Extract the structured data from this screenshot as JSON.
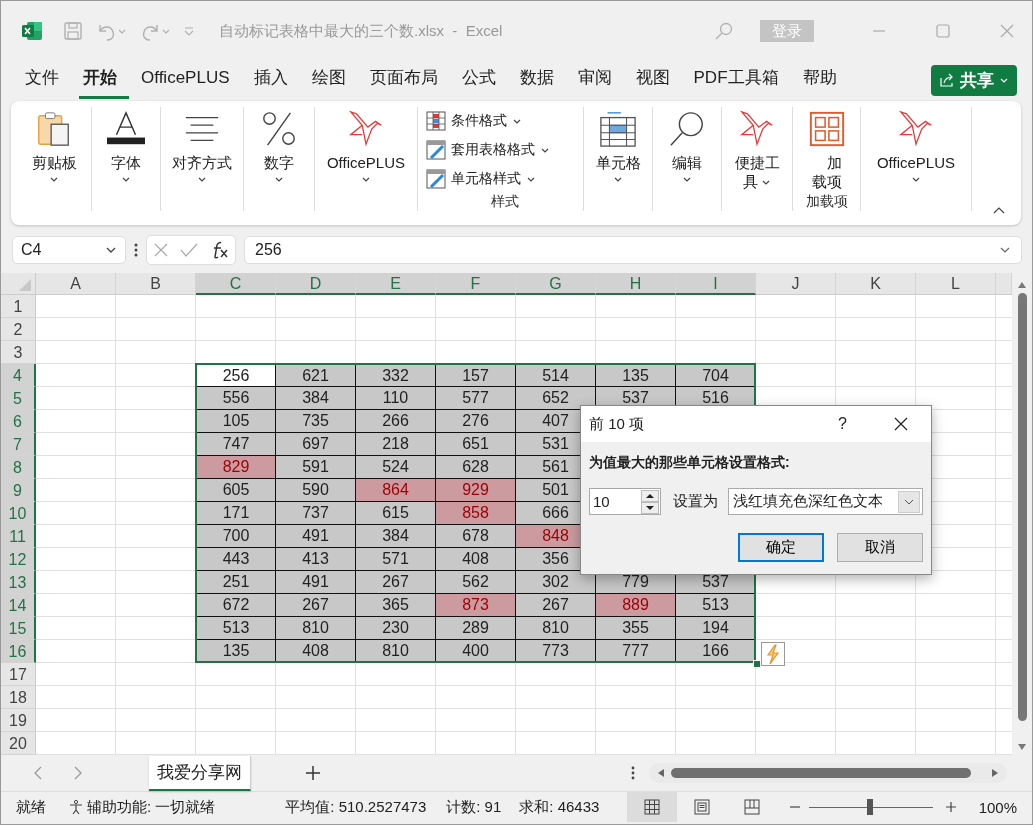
{
  "title_bar": {
    "title": "自动标记表格中最大的三个数.xlsx  -  Excel",
    "sign_in": "登录"
  },
  "menu_tabs": [
    {
      "label": "文件",
      "selected": false
    },
    {
      "label": "开始",
      "selected": true
    },
    {
      "label": "OfficePLUS",
      "selected": false
    },
    {
      "label": "插入",
      "selected": false
    },
    {
      "label": "绘图",
      "selected": false
    },
    {
      "label": "页面布局",
      "selected": false
    },
    {
      "label": "公式",
      "selected": false
    },
    {
      "label": "数据",
      "selected": false
    },
    {
      "label": "审阅",
      "selected": false
    },
    {
      "label": "视图",
      "selected": false
    },
    {
      "label": "PDF工具箱",
      "selected": false
    },
    {
      "label": "帮助",
      "selected": false
    }
  ],
  "share_button": "共享",
  "ribbon": {
    "items": [
      {
        "kind": "large",
        "label": "剪贴板",
        "dropdown": true
      },
      {
        "kind": "large",
        "label": "字体",
        "dropdown": true
      },
      {
        "kind": "large",
        "label": "对齐方式",
        "dropdown": true
      },
      {
        "kind": "large",
        "label": "数字",
        "dropdown": true
      },
      {
        "kind": "large",
        "label": "OfficePLUS",
        "dropdown": true
      },
      {
        "kind": "stack",
        "entries": [
          "条件格式",
          "套用表格格式",
          "单元格样式"
        ],
        "group_label": "样式"
      },
      {
        "kind": "large",
        "label": "单元格",
        "dropdown": true
      },
      {
        "kind": "large",
        "label": "编辑",
        "dropdown": true
      },
      {
        "kind": "large",
        "label": "便捷工具",
        "dropdown": true
      },
      {
        "kind": "large",
        "label": "加载项",
        "dropdown": false,
        "group_label": "加载项"
      },
      {
        "kind": "large",
        "label": "OfficePLUS",
        "dropdown": true
      }
    ]
  },
  "formula_bar": {
    "name_box": "C4",
    "formula": "256"
  },
  "sheet": {
    "columns": [
      {
        "label": "A",
        "selected": false
      },
      {
        "label": "B",
        "selected": false
      },
      {
        "label": "C",
        "selected": true
      },
      {
        "label": "D",
        "selected": true
      },
      {
        "label": "E",
        "selected": true
      },
      {
        "label": "F",
        "selected": true
      },
      {
        "label": "G",
        "selected": true
      },
      {
        "label": "H",
        "selected": true
      },
      {
        "label": "I",
        "selected": true
      },
      {
        "label": "J",
        "selected": false
      },
      {
        "label": "K",
        "selected": false
      },
      {
        "label": "L",
        "selected": false
      }
    ],
    "row_headers": [
      {
        "label": "1",
        "selected": false
      },
      {
        "label": "2",
        "selected": false
      },
      {
        "label": "3",
        "selected": false
      },
      {
        "label": "4",
        "selected": true
      },
      {
        "label": "5",
        "selected": true
      },
      {
        "label": "6",
        "selected": true
      },
      {
        "label": "7",
        "selected": true
      },
      {
        "label": "8",
        "selected": true
      },
      {
        "label": "9",
        "selected": true
      },
      {
        "label": "10",
        "selected": true
      },
      {
        "label": "11",
        "selected": true
      },
      {
        "label": "12",
        "selected": true
      },
      {
        "label": "13",
        "selected": true
      },
      {
        "label": "14",
        "selected": true
      },
      {
        "label": "15",
        "selected": true
      },
      {
        "label": "16",
        "selected": true
      },
      {
        "label": "17",
        "selected": false
      },
      {
        "label": "18",
        "selected": false
      },
      {
        "label": "19",
        "selected": false
      },
      {
        "label": "20",
        "selected": false
      }
    ],
    "data": [
      [
        {
          "text": "256",
          "highlight": false,
          "active": true
        },
        {
          "text": "621",
          "highlight": false,
          "active": false
        },
        {
          "text": "332",
          "highlight": false,
          "active": false
        },
        {
          "text": "157",
          "highlight": false,
          "active": false
        },
        {
          "text": "514",
          "highlight": false,
          "active": false
        },
        {
          "text": "135",
          "highlight": false,
          "active": false
        },
        {
          "text": "704",
          "highlight": false,
          "active": false
        }
      ],
      [
        {
          "text": "556",
          "highlight": false,
          "active": false
        },
        {
          "text": "384",
          "highlight": false,
          "active": false
        },
        {
          "text": "110",
          "highlight": false,
          "active": false
        },
        {
          "text": "577",
          "highlight": false,
          "active": false
        },
        {
          "text": "652",
          "highlight": false,
          "active": false
        },
        {
          "text": "537",
          "highlight": false,
          "active": false
        },
        {
          "text": "516",
          "highlight": false,
          "active": false
        }
      ],
      [
        {
          "text": "105",
          "highlight": false,
          "active": false
        },
        {
          "text": "735",
          "highlight": false,
          "active": false
        },
        {
          "text": "266",
          "highlight": false,
          "active": false
        },
        {
          "text": "276",
          "highlight": false,
          "active": false
        },
        {
          "text": "407",
          "highlight": false,
          "active": false
        }
      ],
      [
        {
          "text": "747",
          "highlight": false,
          "active": false
        },
        {
          "text": "697",
          "highlight": false,
          "active": false
        },
        {
          "text": "218",
          "highlight": false,
          "active": false
        },
        {
          "text": "651",
          "highlight": false,
          "active": false
        },
        {
          "text": "531",
          "highlight": false,
          "active": false
        }
      ],
      [
        {
          "text": "829",
          "highlight": true,
          "active": false
        },
        {
          "text": "591",
          "highlight": false,
          "active": false
        },
        {
          "text": "524",
          "highlight": false,
          "active": false
        },
        {
          "text": "628",
          "highlight": false,
          "active": false
        },
        {
          "text": "561",
          "highlight": false,
          "active": false
        }
      ],
      [
        {
          "text": "605",
          "highlight": false,
          "active": false
        },
        {
          "text": "590",
          "highlight": false,
          "active": false
        },
        {
          "text": "864",
          "highlight": true,
          "active": false
        },
        {
          "text": "929",
          "highlight": true,
          "active": false
        },
        {
          "text": "501",
          "highlight": false,
          "active": false
        }
      ],
      [
        {
          "text": "171",
          "highlight": false,
          "active": false
        },
        {
          "text": "737",
          "highlight": false,
          "active": false
        },
        {
          "text": "615",
          "highlight": false,
          "active": false
        },
        {
          "text": "858",
          "highlight": true,
          "active": false
        },
        {
          "text": "666",
          "highlight": false,
          "active": false
        }
      ],
      [
        {
          "text": "700",
          "highlight": false,
          "active": false
        },
        {
          "text": "491",
          "highlight": false,
          "active": false
        },
        {
          "text": "384",
          "highlight": false,
          "active": false
        },
        {
          "text": "678",
          "highlight": false,
          "active": false
        },
        {
          "text": "848",
          "highlight": true,
          "active": false
        }
      ],
      [
        {
          "text": "443",
          "highlight": false,
          "active": false
        },
        {
          "text": "413",
          "highlight": false,
          "active": false
        },
        {
          "text": "571",
          "highlight": false,
          "active": false
        },
        {
          "text": "408",
          "highlight": false,
          "active": false
        },
        {
          "text": "356",
          "highlight": false,
          "active": false
        }
      ],
      [
        {
          "text": "251",
          "highlight": false,
          "active": false
        },
        {
          "text": "491",
          "highlight": false,
          "active": false
        },
        {
          "text": "267",
          "highlight": false,
          "active": false
        },
        {
          "text": "562",
          "highlight": false,
          "active": false
        },
        {
          "text": "302",
          "highlight": false,
          "active": false
        },
        {
          "text": "779",
          "highlight": false,
          "active": false
        },
        {
          "text": "537",
          "highlight": false,
          "active": false
        }
      ],
      [
        {
          "text": "672",
          "highlight": false,
          "active": false
        },
        {
          "text": "267",
          "highlight": false,
          "active": false
        },
        {
          "text": "365",
          "highlight": false,
          "active": false
        },
        {
          "text": "873",
          "highlight": true,
          "active": false
        },
        {
          "text": "267",
          "highlight": false,
          "active": false
        },
        {
          "text": "889",
          "highlight": true,
          "active": false
        },
        {
          "text": "513",
          "highlight": false,
          "active": false
        }
      ],
      [
        {
          "text": "513",
          "highlight": false,
          "active": false
        },
        {
          "text": "810",
          "highlight": false,
          "active": false
        },
        {
          "text": "230",
          "highlight": false,
          "active": false
        },
        {
          "text": "289",
          "highlight": false,
          "active": false
        },
        {
          "text": "810",
          "highlight": false,
          "active": false
        },
        {
          "text": "355",
          "highlight": false,
          "active": false
        },
        {
          "text": "194",
          "highlight": false,
          "active": false
        }
      ],
      [
        {
          "text": "135",
          "highlight": false,
          "active": false
        },
        {
          "text": "408",
          "highlight": false,
          "active": false
        },
        {
          "text": "810",
          "highlight": false,
          "active": false
        },
        {
          "text": "400",
          "highlight": false,
          "active": false
        },
        {
          "text": "773",
          "highlight": false,
          "active": false
        },
        {
          "text": "777",
          "highlight": false,
          "active": false
        },
        {
          "text": "166",
          "highlight": false,
          "active": false
        }
      ]
    ]
  },
  "sheet_tabs": [
    {
      "label": "我爱分享网",
      "selected": true
    }
  ],
  "dialog": {
    "title": "前 10 项",
    "help": "?",
    "prompt": "为值最大的那些单元格设置格式:",
    "count": "10",
    "set_label": "设置为",
    "format": "浅红填充色深红色文本",
    "buttons": [
      {
        "label": "确定",
        "default": true
      },
      {
        "label": "取消",
        "default": false
      }
    ]
  },
  "status_bar": {
    "ready": "就绪",
    "accessibility": "辅助功能: 一切就绪",
    "average": "平均值: 510.2527473",
    "count": "计数: 91",
    "sum": "求和: 46433",
    "views": [
      {
        "selected": true
      },
      {
        "selected": false
      },
      {
        "selected": false
      }
    ],
    "zoom": {
      "level": 0.5,
      "reading": "100%"
    }
  }
}
